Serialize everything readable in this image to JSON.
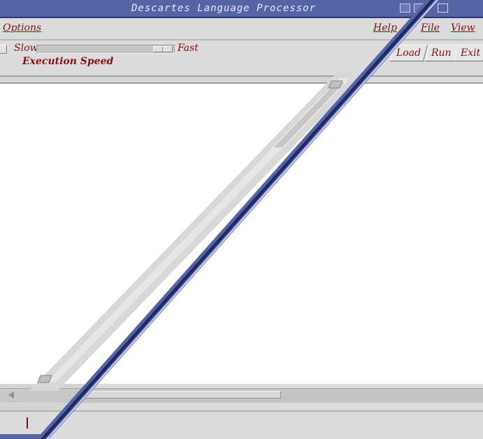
{
  "window": {
    "title": "Descartes Language Processor"
  },
  "menu_left": {
    "options_label": "Options",
    "help_label": "Help"
  },
  "speed": {
    "slow_label": "Slow",
    "fast_label": "Fast",
    "caption": "Execution Speed"
  },
  "menu_right": {
    "file_label": "File",
    "view_label": "View"
  },
  "toolbar_right": {
    "load_label": "Load",
    "run_label": "Run",
    "exit_label": "Exit"
  },
  "colors": {
    "titlebar": "#5464a4",
    "label_text": "#8a0d0d",
    "panel": "#dcdcdc",
    "workarea": "#ffffff"
  }
}
